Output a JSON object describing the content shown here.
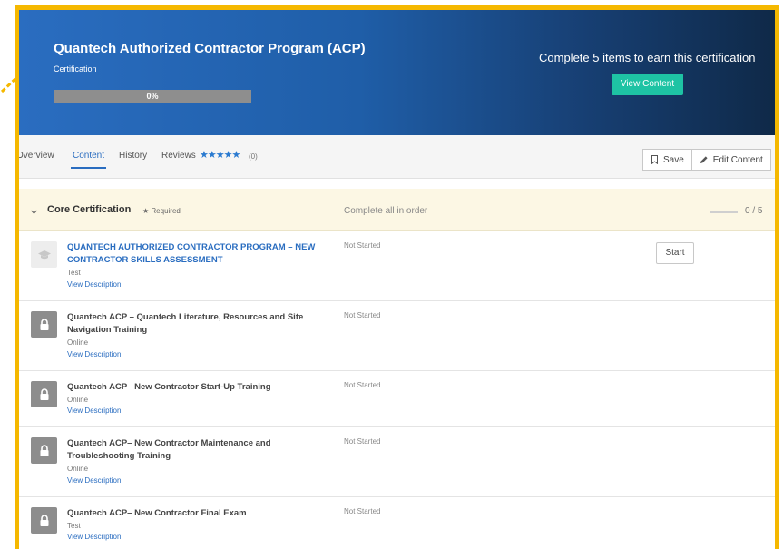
{
  "banner": {
    "title": "Quantech Authorized Contractor Program (ACP)",
    "subtitle": "Certification",
    "progress_label": "0%",
    "progress_value": 0,
    "cta_text": "Complete 5 items to earn this certification",
    "view_button": "View Content"
  },
  "tabs": [
    {
      "label": "Overview"
    },
    {
      "label": "Content"
    },
    {
      "label": "History"
    },
    {
      "label": "Reviews"
    }
  ],
  "reviews": {
    "stars": "★★★★★",
    "count": "(0)"
  },
  "actions": {
    "save": "Save",
    "edit": "Edit Content"
  },
  "section": {
    "title": "Core Certification",
    "required": "★ Required",
    "order": "Complete all in order",
    "progress": "0 / 5"
  },
  "items": [
    {
      "name": "QUANTECH AUTHORIZED CONTRACTOR PROGRAM – NEW CONTRACTOR SKILLS ASSESSMENT",
      "type": "Test",
      "desc": "View Description",
      "status": "Not Started",
      "start": "Start"
    },
    {
      "name": "Quantech ACP – Quantech Literature, Resources and Site Navigation Training",
      "type": "Online",
      "desc": "View Description",
      "status": "Not Started"
    },
    {
      "name": "Quantech ACP– New Contractor Start-Up Training",
      "type": "Online",
      "desc": "View Description",
      "status": "Not Started"
    },
    {
      "name": "Quantech ACP– New Contractor Maintenance and Troubleshooting Training",
      "type": "Online",
      "desc": "View Description",
      "status": "Not Started"
    },
    {
      "name": "Quantech ACP– New Contractor Final Exam",
      "type": "Test",
      "desc": "View Description",
      "status": "Not Started"
    }
  ],
  "colors": {
    "accent": "#2a6dc0",
    "highlight": "#f5b800",
    "cta": "#1ec3a4"
  }
}
